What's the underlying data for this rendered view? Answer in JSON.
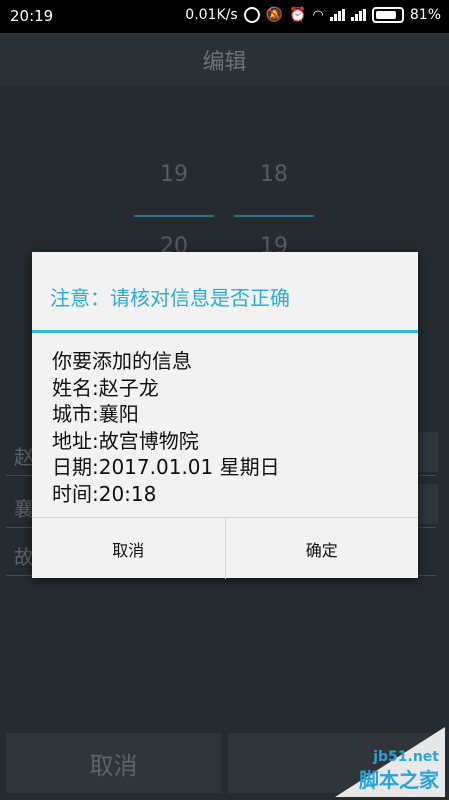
{
  "status_bar": {
    "time": "20:19",
    "net_speed": "0.01K/s",
    "battery": "81%",
    "icons": [
      "sync-icon",
      "mute-icon",
      "alarm-icon",
      "wifi-icon",
      "signal-icon",
      "signal-icon",
      "battery-icon"
    ]
  },
  "header": {
    "title": "编辑"
  },
  "picker": {
    "col1": {
      "prev": "19",
      "current": "20"
    },
    "col2": {
      "prev": "18",
      "current": "19"
    }
  },
  "background_fields": [
    "赵",
    "襄",
    "故"
  ],
  "bottom_buttons": {
    "cancel": "取消"
  },
  "dialog": {
    "title": "注意：请核对信息是否正确",
    "lines": [
      "你要添加的信息",
      "姓名:赵子龙",
      "城市:襄阳",
      "地址:故宫博物院",
      "日期:2017.01.01 星期日",
      "时间:20:18"
    ],
    "cancel": "取消",
    "confirm": "确定"
  },
  "watermark": {
    "url": "jb51.net",
    "text": "脚本之家"
  }
}
